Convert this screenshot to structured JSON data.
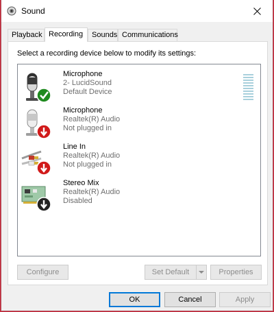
{
  "window": {
    "title": "Sound",
    "close_glyph": "✕"
  },
  "tabs": [
    {
      "label": "Playback",
      "active": false
    },
    {
      "label": "Recording",
      "active": true
    },
    {
      "label": "Sounds",
      "active": false
    },
    {
      "label": "Communications",
      "active": false
    }
  ],
  "panel": {
    "instruction": "Select a recording device below to modify its settings:"
  },
  "devices": [
    {
      "name": "Microphone",
      "driver": "2- LucidSound",
      "status": "Default Device",
      "icon": "microphone-icon",
      "badge": "check-badge-icon"
    },
    {
      "name": "Microphone",
      "driver": "Realtek(R) Audio",
      "status": "Not plugged in",
      "icon": "microphone-icon",
      "badge": "unplugged-badge-icon"
    },
    {
      "name": "Line In",
      "driver": "Realtek(R) Audio",
      "status": "Not plugged in",
      "icon": "line-in-jack-icon",
      "badge": "unplugged-badge-icon"
    },
    {
      "name": "Stereo Mix",
      "driver": "Realtek(R) Audio",
      "status": "Disabled",
      "icon": "sound-card-icon",
      "badge": "disabled-badge-icon"
    }
  ],
  "buttons": {
    "configure": "Configure",
    "set_default": "Set Default",
    "properties": "Properties",
    "ok": "OK",
    "cancel": "Cancel",
    "apply": "Apply"
  },
  "colors": {
    "accent": "#0078d7",
    "success_badge": "#1e8a1e",
    "unplugged_badge": "#d11b1b",
    "disabled_badge": "#222222",
    "level_meter": "#a8d0dc"
  }
}
